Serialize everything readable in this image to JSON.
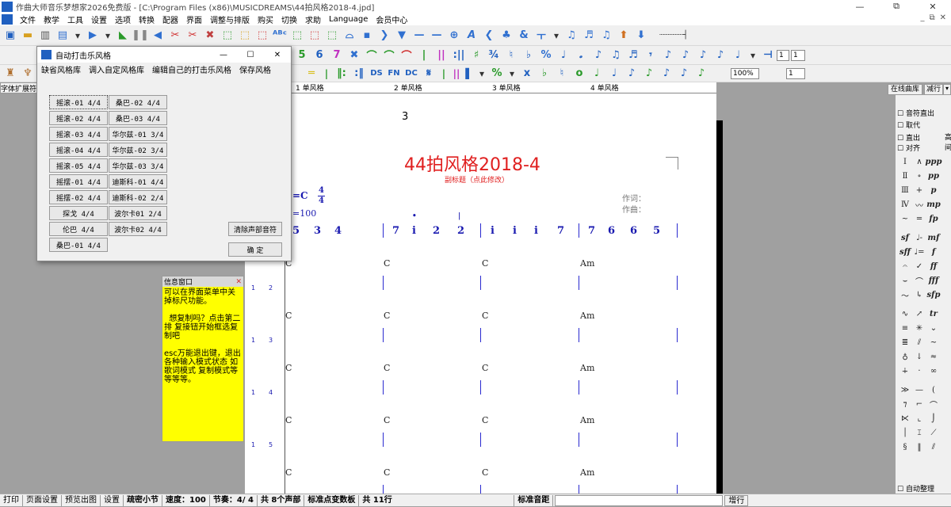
{
  "window": {
    "title": "作曲大师音乐梦想家2026免费版 - [C:\\Program Files (x86)\\MUSICDREAMS\\44拍风格2018-4.jpd]",
    "controls": [
      "—",
      "⧉",
      "✕"
    ]
  },
  "menu": [
    "文件",
    "教学",
    "工具",
    "设置",
    "选项",
    "转换",
    "配器",
    "界面",
    "调整与排版",
    "购买",
    "切换",
    "求助",
    "Language",
    "会员中心"
  ],
  "mdi_controls": [
    "_",
    "⧉",
    "✕"
  ],
  "toolbar2": {
    "spin1": "1",
    "spin2": "1"
  },
  "toolbar3": {
    "zoom": "100%",
    "spin": "1"
  },
  "left_label": "字体扩展符",
  "ruler": {
    "labels": [
      "1 单风格",
      "2 单风格",
      "3 单风格",
      "4 单风格"
    ]
  },
  "score": {
    "page_number": "3",
    "title": "44拍风格2018-4",
    "subtitle": "副标题（点此修改）",
    "key": "=C",
    "time_top": "4",
    "time_bottom": "4",
    "tempo": "=100",
    "lyricist": "作词：",
    "composer": "作曲：",
    "measures": [
      {
        "notes": [
          "5",
          "3",
          "4"
        ]
      },
      {
        "notes": [
          "7",
          "i",
          "2",
          "2"
        ]
      },
      {
        "notes": [
          "i",
          "i",
          "i",
          "7"
        ]
      },
      {
        "notes": [
          "7",
          "6",
          "6",
          "5"
        ]
      }
    ],
    "chords": [
      "C",
      "C",
      "C",
      "Am"
    ],
    "line_numbers": [
      "1",
      "2",
      "1",
      "3",
      "1",
      "4",
      "1",
      "5"
    ]
  },
  "dialog": {
    "title": "自动打击乐风格",
    "menu": [
      "缺省风格库",
      "调入自定风格库",
      "编辑自己的打击乐风格",
      "保存风格"
    ],
    "styles_left": [
      "摇滚-01 4/4",
      "摇滚-02 4/4",
      "摇滚-03 4/4",
      "摇滚-04 4/4",
      "摇滚-05 4/4",
      "摇摆-01 4/4",
      "摇摆-02 4/4",
      "探戈 4/4",
      "伦巴 4/4",
      "桑巴-01 4/4"
    ],
    "styles_right": [
      "桑巴-02 4/4",
      "桑巴-03 4/4",
      "华尔兹-01 3/4",
      "华尔兹-02 3/4",
      "华尔兹-03 3/4",
      "迪斯科-01 4/4",
      "迪斯科-02 2/4",
      "波尔卡01 2/4",
      "波尔卡02 4/4"
    ],
    "clear_button": "清除声部音符",
    "ok_button": "确  定",
    "controls": [
      "—",
      "☐",
      "✕"
    ]
  },
  "info_window": {
    "title": "信息窗口",
    "text": "可以在界面菜单中关掉标尺功能。\n\n  想复制吗？点击第二排 复接钮开始框选复制吧\n\nesc万能退出键，退出各种输入模式状态 如歌词模式 复制模式等等等等。"
  },
  "right_panel": {
    "top_button1": "在线曲库",
    "top_button2": "减行",
    "check_sound": "音符直出",
    "check_replace": "取代",
    "check_out": "直出",
    "check_align": "对齐",
    "side_high": "高",
    "side_space": "间",
    "auto_arrange": "自动整理",
    "add_line": "增行"
  },
  "status": [
    "打印",
    "页面设置",
    "预览出图",
    "设置",
    "疏密小节",
    "速度：100",
    "节奏：4/ 4",
    "共 8个声部",
    "标准点变数板",
    "共 11行",
    "标准音距"
  ]
}
